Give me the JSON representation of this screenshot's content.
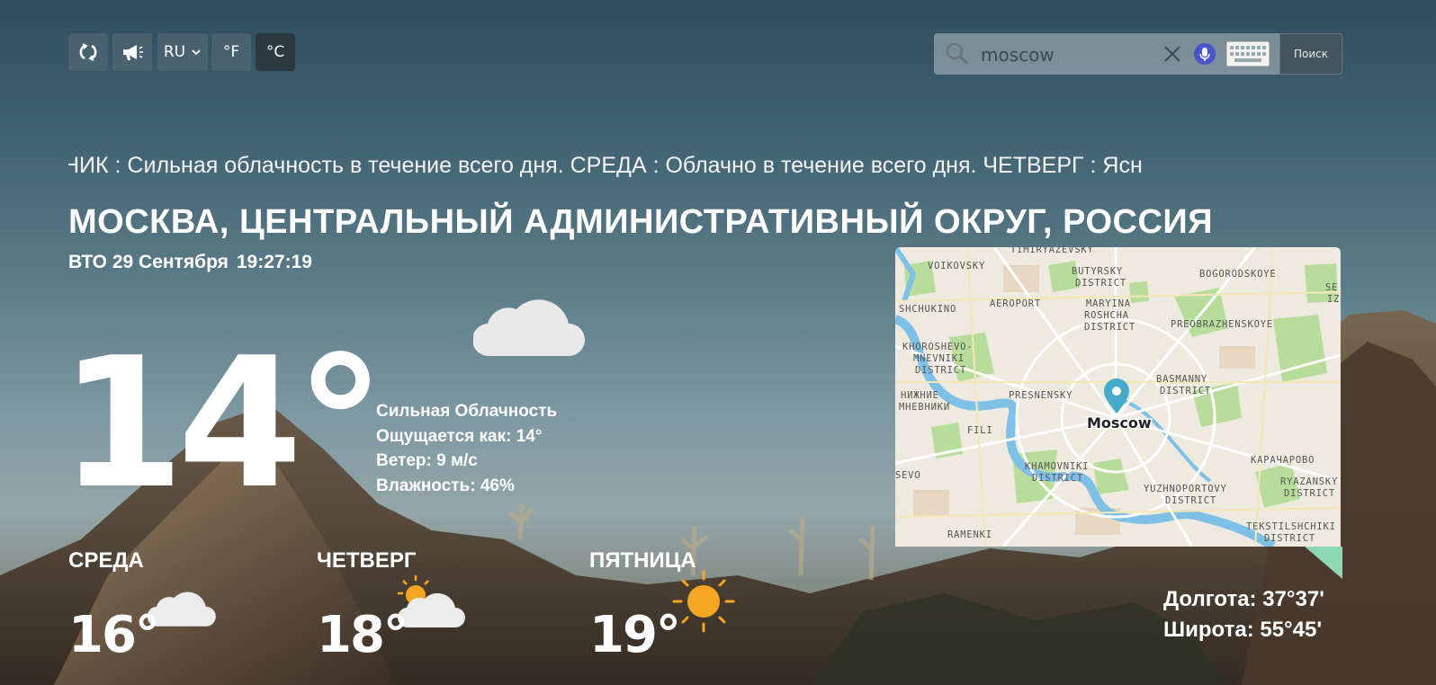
{
  "toolbar": {
    "refresh_icon": "refresh-icon",
    "speak_icon": "megaphone-icon",
    "language": "RU",
    "fahrenheit": "°F",
    "celsius": "°C"
  },
  "search": {
    "value": "moscow",
    "button": "Поиск",
    "icons": [
      "search-icon",
      "clear-icon",
      "microphone-icon",
      "keyboard-icon"
    ]
  },
  "ticker": "НИК : Сильная облачность в течение всего дня. СРЕДА : Облачно в течение всего дня. ЧЕТВЕРГ : Ясн",
  "location": {
    "title": "МОСКВА, ЦЕНТРАЛЬНЫЙ АДМИНИСТРАТИВНЫЙ ОКРУГ, РОССИЯ",
    "date": "ВТО 29 Сентября",
    "time": "19:27:19"
  },
  "current": {
    "temperature": "14°",
    "icon": "cloud-icon",
    "condition": "Сильная Облачность",
    "feels_like": "Ощущается как: 14°",
    "wind": "Ветер: 9 м/с",
    "humidity": "Влажность: 46%"
  },
  "map": {
    "marker_label": "Moscow",
    "districts": [
      "TIMIRYAZEVSKY",
      "VOIKOVSKY",
      "BUTYRSKY",
      "DISTRICT",
      "BOGORODSKOYE",
      "AEROPORT",
      "MARYINA",
      "ROSHCHA",
      "DISTRICT",
      "SHCHUKINO",
      "PREOBRAZHENSKOYE",
      "KHOROSHEVO-",
      "MNEVNIKI",
      "DISTRICT",
      "BASMANNY",
      "DISTRICT",
      "НИЖНИЕ",
      "МНЕВНИКИ",
      "PRESNENSKY",
      "FILI",
      "КАРАЧАРОВО",
      "KHAMOVNIKI",
      "DISTRICT",
      "RYAZANSKY",
      "DISTRICT",
      "YUZHNOPORTOVY",
      "DISTRICT",
      "SEVO",
      "TEKSTILSHCHIKI",
      "DISTRICT",
      "RAMENKI",
      "SE",
      "IZ"
    ]
  },
  "forecast": [
    {
      "day": "СРЕДА",
      "temp": "16°",
      "icon": "cloud-icon"
    },
    {
      "day": "ЧЕТВЕРГ",
      "temp": "18°",
      "icon": "partly-cloudy-icon"
    },
    {
      "day": "ПЯТНИЦА",
      "temp": "19°",
      "icon": "sun-icon"
    }
  ],
  "coordinates": {
    "longitude": "Долгота: 37°37'",
    "latitude": "Широта: 55°45'"
  },
  "colors": {
    "sun": "#f5a623",
    "map_water": "#7fc0e6",
    "map_park": "#b7dd9a",
    "marker": "#45a9c9"
  }
}
